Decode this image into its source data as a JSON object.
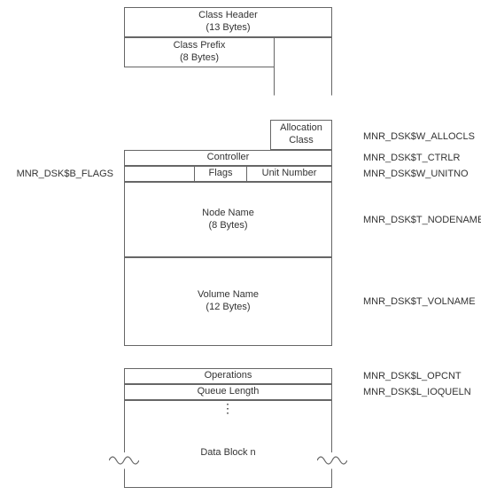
{
  "header": {
    "class_header": {
      "title": "Class Header",
      "subtitle": "(13 Bytes)"
    },
    "class_prefix": {
      "title": "Class Prefix",
      "subtitle": "(8 Bytes)"
    }
  },
  "alloc_class": "Allocation\nClass",
  "controller": "Controller",
  "flags": "Flags",
  "unit_number": "Unit Number",
  "node_name": {
    "title": "Node Name",
    "subtitle": "(8 Bytes)"
  },
  "volume_name": {
    "title": "Volume Name",
    "subtitle": "(12 Bytes)"
  },
  "operations": "Operations",
  "queue_length": "Queue Length",
  "data_block_n": "Data Block n",
  "labels": {
    "allocls": "MNR_DSK$W_ALLOCLS",
    "ctrlr": "MNR_DSK$T_CTRLR",
    "unitno": "MNR_DSK$W_UNITNO",
    "b_flags": "MNR_DSK$B_FLAGS",
    "nodename": "MNR_DSK$T_NODENAME",
    "volname": "MNR_DSK$T_VOLNAME",
    "opcnt": "MNR_DSK$L_OPCNT",
    "ioqueln": "MNR_DSK$L_IOQUELN"
  }
}
